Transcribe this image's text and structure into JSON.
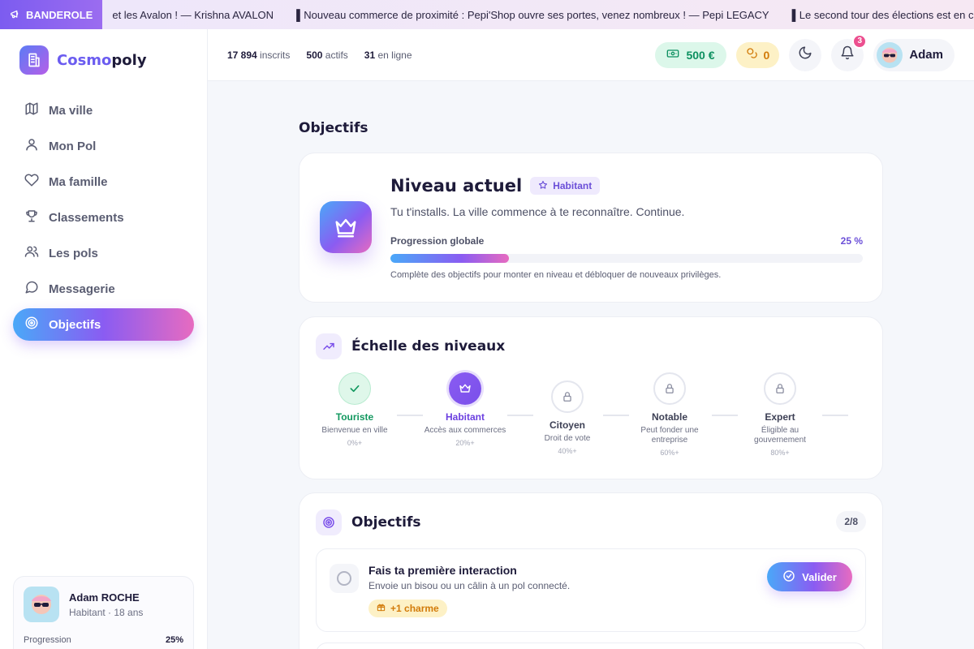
{
  "banner": {
    "tag": "BANDEROLE",
    "messages": [
      "et les Avalon ! — Krishna AVALON",
      "▌Nouveau commerce de proximité : Pepi'Shop ouvre ses portes, venez nombreux ! — Pepi LEGACY",
      "▌Le second tour des élections est en c"
    ]
  },
  "app": {
    "name_part1": "Cosmo",
    "name_part2": "poly"
  },
  "sidebar": {
    "items": [
      {
        "label": "Ma ville",
        "icon": "map-icon"
      },
      {
        "label": "Mon Pol",
        "icon": "user-icon"
      },
      {
        "label": "Ma famille",
        "icon": "heart-icon"
      },
      {
        "label": "Classements",
        "icon": "trophy-icon"
      },
      {
        "label": "Les pols",
        "icon": "users-icon"
      },
      {
        "label": "Messagerie",
        "icon": "message-icon"
      },
      {
        "label": "Objectifs",
        "icon": "target-icon",
        "active": true
      }
    ],
    "user_card": {
      "name": "Adam ROCHE",
      "subtitle": "Habitant · 18 ans",
      "progress_label": "Progression",
      "progress_value": "25%",
      "progress": 0.25
    }
  },
  "header": {
    "stats": [
      {
        "value": "17 894",
        "label": "inscrits"
      },
      {
        "value": "500",
        "label": "actifs"
      },
      {
        "value": "31",
        "label": "en ligne"
      }
    ],
    "money": "500 €",
    "charm": "0",
    "notifications": "3",
    "user": "Adam"
  },
  "page": {
    "title": "Objectifs"
  },
  "level": {
    "title": "Niveau actuel",
    "badge": "Habitant",
    "description": "Tu t'installs. La ville commence à te reconnaître. Continue.",
    "progress_label": "Progression globale",
    "progress_value": "25 %",
    "progress": 0.25,
    "hint": "Complète des objectifs pour monter en niveau et débloquer de nouveaux privilèges."
  },
  "ladder": {
    "title": "Échelle des niveaux",
    "steps": [
      {
        "name": "Touriste",
        "desc": "Bienvenue en ville",
        "pct": "0%+",
        "state": "done"
      },
      {
        "name": "Habitant",
        "desc": "Accès aux commerces",
        "pct": "20%+",
        "state": "current"
      },
      {
        "name": "Citoyen",
        "desc": "Droit de vote",
        "pct": "40%+",
        "state": "locked"
      },
      {
        "name": "Notable",
        "desc": "Peut fonder une entreprise",
        "pct": "60%+",
        "state": "locked"
      },
      {
        "name": "Expert",
        "desc": "Éligible au gouvernement",
        "pct": "80%+",
        "state": "locked"
      }
    ]
  },
  "objectives": {
    "title": "Objectifs",
    "count": "2/8",
    "tasks": [
      {
        "title": "Fais ta première interaction",
        "desc": "Envoie un bisou ou un câlin à un pol connecté.",
        "reward": "+1 charme",
        "button": "Valider"
      }
    ]
  },
  "colors": {
    "accent": "#8a5cf2",
    "gradient_start": "#4aa8f8",
    "gradient_end": "#e76bc0",
    "success": "#12985f",
    "charm": "#d27b0a"
  }
}
